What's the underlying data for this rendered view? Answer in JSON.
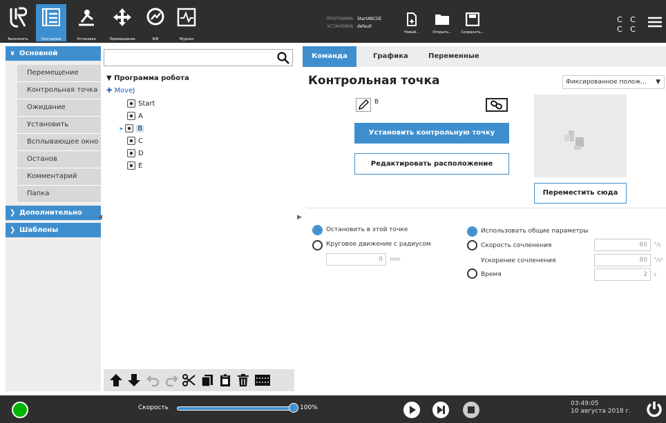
{
  "topbar": {
    "buttons": [
      {
        "label": "Выполнить",
        "icon": "ur-logo-icon"
      },
      {
        "label": "Программа",
        "icon": "program-icon"
      },
      {
        "label": "Установка",
        "icon": "installation-icon"
      },
      {
        "label": "Перемещение",
        "icon": "move-icon"
      },
      {
        "label": "В/В",
        "icon": "io-icon"
      },
      {
        "label": "Журнал",
        "icon": "log-icon"
      }
    ],
    "program_key": "ПРОГРАММА",
    "program_value": "StartABCDE",
    "install_key": "УСТАНОВКА",
    "install_value": "default",
    "file_buttons": [
      {
        "label": "Новый..."
      },
      {
        "label": "Открыть..."
      },
      {
        "label": "Сохранить..."
      }
    ],
    "cc_line1": "C C",
    "cc_line2": "C C"
  },
  "sidebar": {
    "basic": "Основной",
    "items": [
      "Перемещение",
      "Контрольная точка",
      "Ожидание",
      "Установить",
      "Всплывающее окно",
      "Останов",
      "Комментарий",
      "Папка"
    ],
    "advanced": "Дополнительно",
    "templates": "Шаблоны"
  },
  "tree": {
    "root": "Программа робота",
    "movej": "MoveJ",
    "nodes": [
      "Start",
      "A",
      "B",
      "C",
      "D",
      "E"
    ],
    "selected": "B"
  },
  "tabs": [
    "Команда",
    "Графика",
    "Переменные"
  ],
  "main": {
    "title": "Контрольная точка",
    "mode": "Фиксированное полож...",
    "waypoint_name": "B",
    "set_waypoint": "Установить контрольную точку",
    "edit_pose": "Редактировать расположение",
    "move_here": "Переместить сюда",
    "stop_at_point": "Остановить в этой точке",
    "blend_radius": "Круговое движение с радиусом",
    "blend_value": "0",
    "blend_unit": "mm",
    "use_shared": "Использовать общие параметры",
    "joint_speed": "Скорость сочленения",
    "joint_speed_value": "60",
    "joint_speed_unit": "°/s",
    "joint_accel": "Ускорение сочленения",
    "joint_accel_value": "80",
    "joint_accel_unit": "°/s²",
    "time": "Время",
    "time_value": "2",
    "time_unit": "s"
  },
  "bottombar": {
    "speed_label": "Скорость",
    "speed_value": "100%",
    "speed_fraction": 1.0,
    "time": "03:49:05",
    "date": "10 августа 2018 г."
  },
  "colors": {
    "accent": "#3f8fcf",
    "bar": "#2e2e2e",
    "status_ok": "#00b400"
  }
}
